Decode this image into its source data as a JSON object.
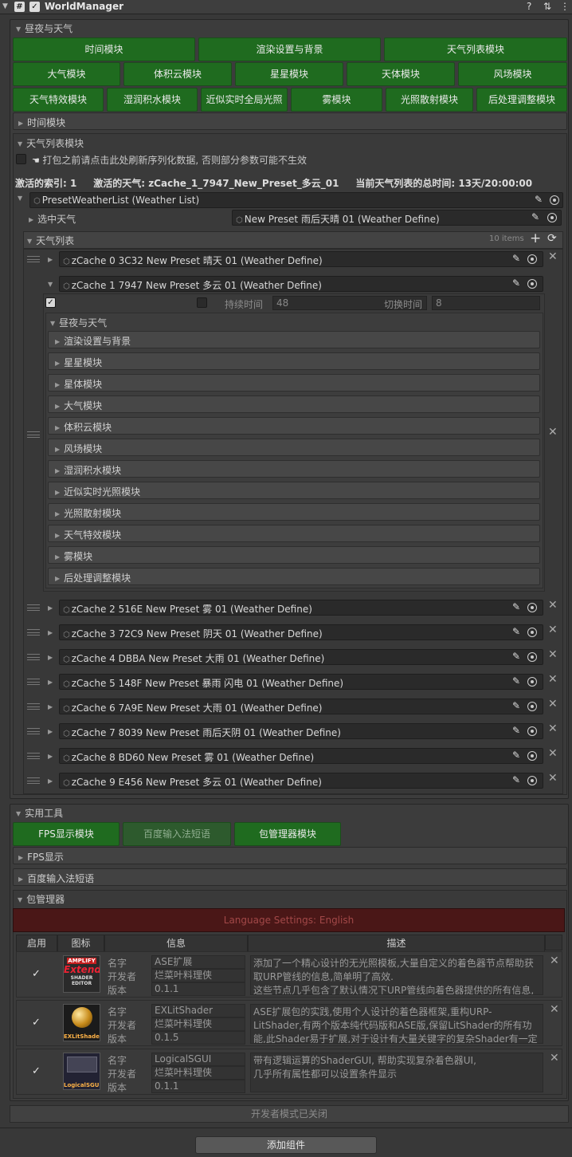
{
  "header": {
    "title": "WorldManager",
    "hash_glyph": "#",
    "help_icon": "?",
    "settings_icon": "⇅",
    "more_icon": "⋮"
  },
  "section_daynight": {
    "title": "昼夜与天气"
  },
  "module_buttons": {
    "row1": [
      "时间模块",
      "渲染设置与背景",
      "天气列表模块"
    ],
    "row2": [
      "大气模块",
      "体积云模块",
      "星星模块",
      "天体模块",
      "风场模块"
    ],
    "row3": [
      "天气特效模块",
      "湿润积水模块",
      "近似实时全局光照",
      "雾模块",
      "光照散射模块",
      "后处理调整模块"
    ]
  },
  "time_module": {
    "title": "时间模块"
  },
  "weather_list_module": {
    "title": "天气列表模块",
    "pack_hint": "打包之前请点击此处刷新序列化数据, 否则部分参数可能不生效",
    "active_index": "激活的索引: 1",
    "active_weather": "激活的天气: zCache_1_7947_New_Preset_多云_01",
    "total_time": "当前天气列表的总时间: 13天/20:00:00",
    "preset_list": "PresetWeatherList (Weather List)",
    "selected_label": "选中天气",
    "selected_value": "New Preset 雨后天晴 01 (Weather Define)",
    "list_title": "天气列表",
    "items_count": "10 items",
    "add_icon": "+",
    "refresh_icon": "⟳"
  },
  "weather_items": [
    "zCache 0 3C32 New Preset 晴天 01 (Weather Define)",
    "zCache 1 7947 New Preset 多云 01 (Weather Define)",
    "zCache 2 516E New Preset 雾 01 (Weather Define)",
    "zCache 3 72C9 New Preset 阴天 01 (Weather Define)",
    "zCache 4 DBBA New Preset 大雨 01 (Weather Define)",
    "zCache 5 148F New Preset 暴雨 闪电 01 (Weather Define)",
    "zCache 6 7A9E New Preset 大雨 01 (Weather Define)",
    "zCache 7 8039 New Preset 雨后天阴 01 (Weather Define)",
    "zCache 8 BD60 New Preset 雾 01 (Weather Define)",
    "zCache 9 E456 New Preset 多云 01 (Weather Define)"
  ],
  "expanded_item": {
    "duration_label": "持续时间",
    "duration_value": "48",
    "switch_label": "切换时间",
    "switch_value": "8",
    "group_title": "昼夜与天气",
    "sub_modules": [
      "渲染设置与背景",
      "星星模块",
      "星体模块",
      "大气模块",
      "体积云模块",
      "风场模块",
      "湿润积水模块",
      "近似实时光照模块",
      "光照散射模块",
      "天气特效模块",
      "雾模块",
      "后处理调整模块"
    ]
  },
  "utility": {
    "title": "实用工具",
    "buttons": [
      "FPS显示模块",
      "百度输入法短语",
      "包管理器模块"
    ],
    "fps_fold": "FPS显示",
    "baidu_fold": "百度输入法短语",
    "pkg_fold": "包管理器",
    "language_button": "Language Settings: English",
    "table_headers": [
      "启用",
      "图标",
      "信息",
      "描述"
    ],
    "field_labels": {
      "name": "名字",
      "dev": "开发者",
      "ver": "版本"
    },
    "packages": [
      {
        "name": "ASE扩展",
        "dev": "烂菜叶料理侠",
        "ver": "0.1.1",
        "desc": "添加了一个精心设计的无光照模板,大量自定义的着色器节点帮助获取URP管线的信息,简单明了高效.\n这些节点几乎包含了默认情况下URP管线向着色器提供的所有信息,",
        "logo_top": "AMPLIFY",
        "logo_mid": "Extend",
        "logo_bot": "SHADER EDITOR"
      },
      {
        "name": "EXLitShader",
        "dev": "烂菜叶料理侠",
        "ver": "0.1.5",
        "desc": "ASE扩展包的实践,使用个人设计的着色器框架,重构URP-LitShader,有两个版本纯代码版和ASE版,保留LitShader的所有功能,此Shader易于扩展,对于设计有大量关键字的复杂Shader有一定优势",
        "logo_bot": "EXLitShader"
      },
      {
        "name": "LogicalSGUI",
        "dev": "烂菜叶料理侠",
        "ver": "0.1.1",
        "desc": "带有逻辑运算的ShaderGUI, 帮助实现复杂着色器UI,\n几乎所有属性都可以设置条件显示",
        "logo_bot": "LogicalSGUI"
      }
    ]
  },
  "dev_mode": "开发者模式已关闭",
  "add_component": "添加组件",
  "colors": {
    "accent_green": "#1f6b1f",
    "language_red": "#4a1717",
    "panel": "#383838"
  }
}
